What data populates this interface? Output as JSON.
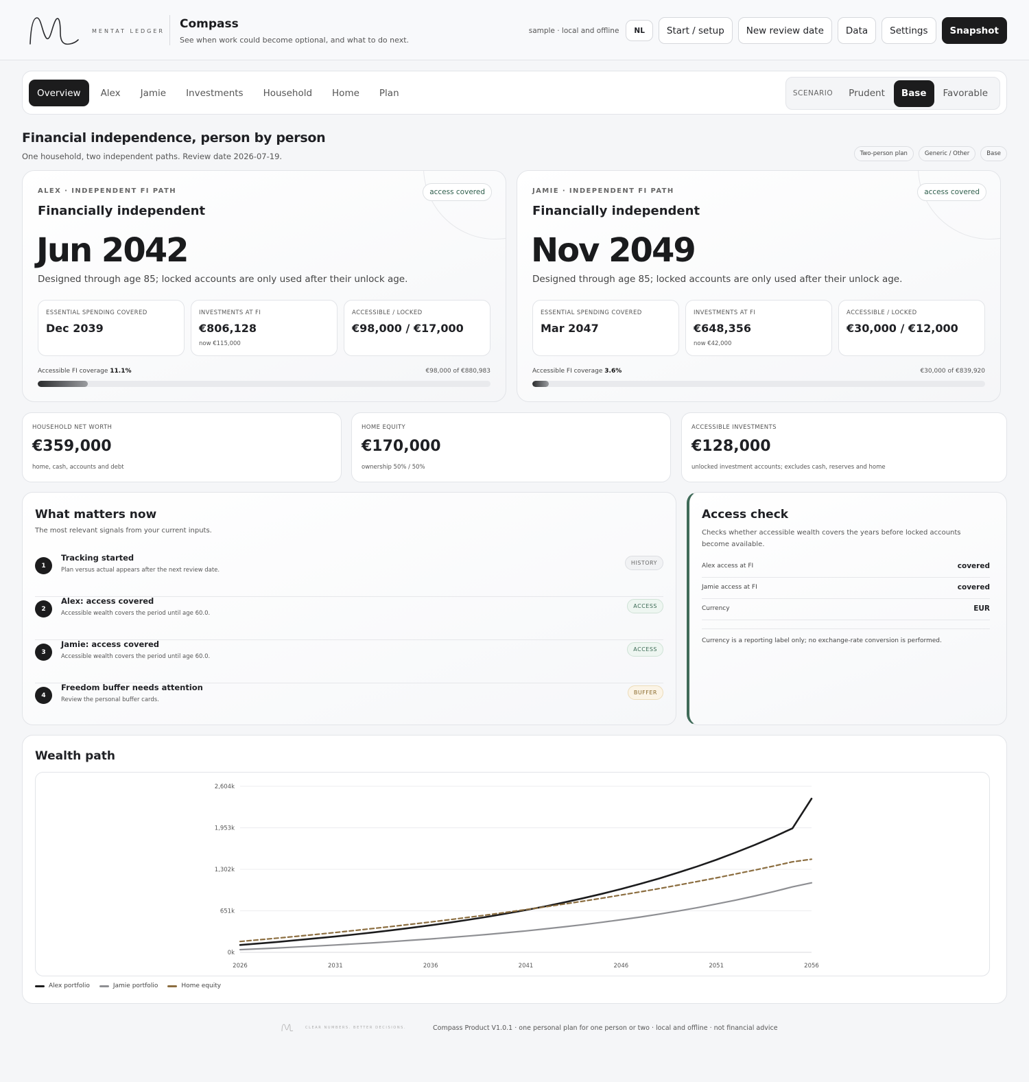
{
  "header": {
    "logo_text": "MENTAT LEDGER",
    "app_title": "Compass",
    "app_subtitle": "See when work could become optional, and what to do next.",
    "mode_note": "sample · local and offline",
    "lang": "NL",
    "buttons": [
      "Start / setup",
      "New review date",
      "Data",
      "Settings",
      "Snapshot"
    ]
  },
  "nav": {
    "tabs": [
      "Overview",
      "Alex",
      "Jamie",
      "Investments",
      "Household",
      "Home",
      "Plan"
    ],
    "active_tab": "Overview",
    "scenario_label": "SCENARIO",
    "scenarios": [
      "Prudent",
      "Base",
      "Favorable"
    ],
    "active_scenario": "Base"
  },
  "section": {
    "title": "Financial independence, person by person",
    "subtitle": "One household, two independent paths. Review date 2026-07-19.",
    "chips": [
      "Two-person plan",
      "Generic / Other",
      "Base"
    ]
  },
  "fi_cards": [
    {
      "kicker": "ALEX · INDEPENDENT FI PATH",
      "badge": "access covered",
      "status": "Financially independent",
      "date": "Jun 2042",
      "note": "Designed through age 85; locked accounts are only used after their unlock age.",
      "metrics": [
        {
          "label": "ESSENTIAL SPENDING COVERED",
          "value": "Dec 2039",
          "sub": ""
        },
        {
          "label": "INVESTMENTS AT FI",
          "value": "€806,128",
          "sub": "now €115,000"
        },
        {
          "label": "ACCESSIBLE / LOCKED",
          "value": "€98,000 / €17,000",
          "sub": ""
        }
      ],
      "coverage_label": "Accessible FI coverage",
      "coverage_value": "11.1%",
      "coverage_fraction": 0.111,
      "coverage_detail": "€98,000 of €880,983"
    },
    {
      "kicker": "JAMIE · INDEPENDENT FI PATH",
      "badge": "access covered",
      "status": "Financially independent",
      "date": "Nov 2049",
      "note": "Designed through age 85; locked accounts are only used after their unlock age.",
      "metrics": [
        {
          "label": "ESSENTIAL SPENDING COVERED",
          "value": "Mar 2047",
          "sub": ""
        },
        {
          "label": "INVESTMENTS AT FI",
          "value": "€648,356",
          "sub": "now €42,000"
        },
        {
          "label": "ACCESSIBLE / LOCKED",
          "value": "€30,000 / €12,000",
          "sub": ""
        }
      ],
      "coverage_label": "Accessible FI coverage",
      "coverage_value": "3.6%",
      "coverage_fraction": 0.036,
      "coverage_detail": "€30,000 of €839,920"
    }
  ],
  "stats": [
    {
      "label": "HOUSEHOLD NET WORTH",
      "value": "€359,000",
      "sub": "home, cash, accounts and debt"
    },
    {
      "label": "HOME EQUITY",
      "value": "€170,000",
      "sub": "ownership 50% / 50%"
    },
    {
      "label": "ACCESSIBLE INVESTMENTS",
      "value": "€128,000",
      "sub": "unlocked investment accounts; excludes cash, reserves and home"
    }
  ],
  "matters": {
    "title": "What matters now",
    "subtitle": "The most relevant signals from your current inputs.",
    "items": [
      {
        "num": "1",
        "title": "Tracking started",
        "sub": "Plan versus actual appears after the next review date.",
        "tag": "HISTORY",
        "tag_color": "#666666",
        "tag_bg": "#f1f2f4",
        "tag_border": "#dcdee2"
      },
      {
        "num": "2",
        "title": "Alex: access covered",
        "sub": "Accessible wealth covers the period until age 60.0.",
        "tag": "ACCESS",
        "tag_color": "#3c6a55",
        "tag_bg": "#eef6f1",
        "tag_border": "#cfe2d6"
      },
      {
        "num": "3",
        "title": "Jamie: access covered",
        "sub": "Accessible wealth covers the period until age 60.0.",
        "tag": "ACCESS",
        "tag_color": "#3c6a55",
        "tag_bg": "#eef6f1",
        "tag_border": "#cfe2d6"
      },
      {
        "num": "4",
        "title": "Freedom buffer needs attention",
        "sub": "Review the personal buffer cards.",
        "tag": "BUFFER",
        "tag_color": "#8a6a2c",
        "tag_bg": "#fbf4e6",
        "tag_border": "#ecdcb8"
      }
    ]
  },
  "access": {
    "title": "Access check",
    "subtitle": "Checks whether accessible wealth covers the years before locked accounts become available.",
    "rows": [
      {
        "key": "Alex access at FI",
        "value": "covered"
      },
      {
        "key": "Jamie access at FI",
        "value": "covered"
      },
      {
        "key": "Currency",
        "value": "EUR"
      }
    ],
    "note": "Currency is a reporting label only; no exchange-rate conversion is performed."
  },
  "wealth": {
    "title": "Wealth path"
  },
  "chart_data": {
    "type": "line",
    "x": [
      2026,
      2027,
      2028,
      2029,
      2030,
      2031,
      2032,
      2033,
      2034,
      2035,
      2036,
      2037,
      2038,
      2039,
      2040,
      2041,
      2042,
      2043,
      2044,
      2045,
      2046,
      2047,
      2048,
      2049,
      2050,
      2051,
      2052,
      2053,
      2054,
      2055,
      2056
    ],
    "x_tick_labels": [
      "2026",
      "2031",
      "2036",
      "2041",
      "2046",
      "2051",
      "2056"
    ],
    "y_tick_labels": [
      "0k",
      "651k",
      "1,302k",
      "1,953k",
      "2,604k"
    ],
    "ylim": [
      0,
      2604
    ],
    "y_unit": "k",
    "grid": true,
    "legend_position": "bottom-left",
    "series": [
      {
        "name": "Alex portfolio",
        "color": "#1c1c1d",
        "style": "solid",
        "values": [
          115,
          139,
          164,
          191,
          219,
          249,
          280,
          313,
          348,
          385,
          424,
          466,
          511,
          558,
          609,
          663,
          720,
          782,
          848,
          918,
          993,
          1073,
          1158,
          1250,
          1347,
          1452,
          1563,
          1682,
          1809,
          1944,
          2410
        ]
      },
      {
        "name": "Jamie portfolio",
        "color": "#8e8f93",
        "style": "solid",
        "values": [
          42,
          55,
          69,
          84,
          99,
          115,
          132,
          150,
          169,
          189,
          210,
          232,
          256,
          281,
          308,
          336,
          367,
          399,
          434,
          471,
          511,
          553,
          599,
          648,
          700,
          757,
          817,
          882,
          951,
          1026,
          1090
        ]
      },
      {
        "name": "Home equity",
        "color": "#8b6d3f",
        "style": "dashed",
        "values": [
          170,
          197,
          224,
          252,
          281,
          311,
          342,
          374,
          407,
          441,
          476,
          512,
          550,
          588,
          628,
          670,
          712,
          756,
          802,
          849,
          898,
          948,
          1000,
          1054,
          1110,
          1168,
          1228,
          1289,
          1353,
          1419,
          1460
        ]
      }
    ]
  },
  "footer": {
    "tagline": "CLEAR NUMBERS. BETTER DECISIONS.",
    "text": "Compass Product V1.0.1 · one personal plan for one person or two · local and offline · not financial advice"
  }
}
